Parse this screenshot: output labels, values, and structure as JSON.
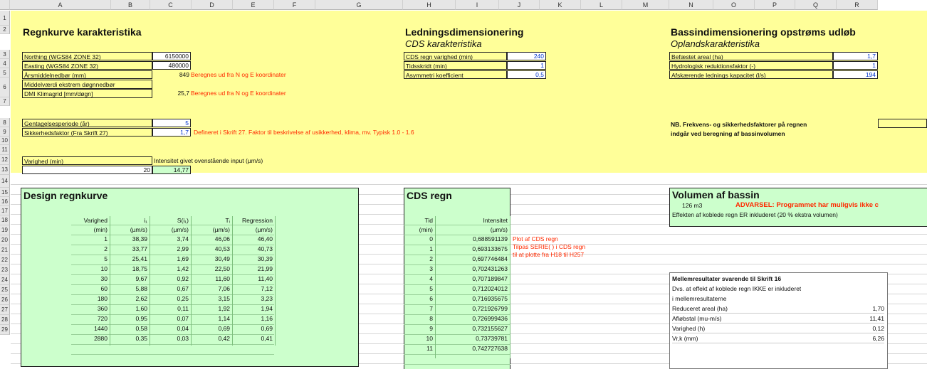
{
  "columns": [
    "A",
    "B",
    "C",
    "D",
    "E",
    "F",
    "G",
    "H",
    "I",
    "J",
    "K",
    "L",
    "M",
    "N",
    "O",
    "P",
    "Q",
    "R"
  ],
  "rows": [
    "1",
    "2",
    "3",
    "4",
    "5",
    "6",
    "",
    "7",
    "8",
    "9",
    "10",
    "11",
    "12",
    "13",
    "14",
    "15",
    "16",
    "17",
    "18",
    "19",
    "20",
    "21",
    "22",
    "23",
    "24",
    "25",
    "26",
    "27",
    "28",
    "29"
  ],
  "regnkurve": {
    "title": "Regnkurve karakteristika",
    "northing_label": "Northing (WGS84 ZONE 32)",
    "northing_value": "6150000",
    "easting_label": "Easting (WGS84 ZONE 32)",
    "easting_value": "480000",
    "aarsmiddel_label": "Årsmiddelnedbør (mm)",
    "aarsmiddel_value": "849",
    "aarsmiddel_note": "Beregnes ud fra N og E koordinater",
    "ekstrem_label1": "Middelværdi ekstrem døgnnedbør",
    "ekstrem_label2": "DMI Klimagrid [mm/døgn]",
    "ekstrem_value": "25,7",
    "ekstrem_note": "Beregnes ud fra N og E koordinater",
    "gentagelse_label": "Gentagelsesperiode (år)",
    "gentagelse_value": "5",
    "sikkerhed_label": "Sikkerhedsfaktor (Fra Skrift 27)",
    "sikkerhed_value": "1,7",
    "sikkerhed_note": "Defineret i Skrift 27. Faktor til beskrivelse af usikkerhed, klima, mv. Typisk 1.0 - 1.6",
    "varighed_label": "Varighed (min)",
    "varighed_value": "20",
    "intensitet_label": "Intensitet givet ovenstående input (µm/s)",
    "intensitet_value": "14,77"
  },
  "ledning": {
    "title": "Ledningsdimensionering",
    "subtitle": "CDS karakteristika",
    "rows": [
      {
        "label": "CDS regn varighed (min)",
        "value": "240"
      },
      {
        "label": "Tidsskridt (min)",
        "value": "1"
      },
      {
        "label": "Asymmetri koefficient",
        "value": "0,5"
      }
    ]
  },
  "bassin": {
    "title": "Bassindimensionering opstrøms udløb",
    "subtitle": "Oplandskarakteristika",
    "rows": [
      {
        "label": "Befæstet areal (ha)",
        "value": "1,7"
      },
      {
        "label": "Hydrologisk reduktionsfaktor (-)",
        "value": "1"
      },
      {
        "label": "Afskærende lednings kapacitet (l/s)",
        "value": "194"
      }
    ],
    "nb_line1": "NB. Frekvens- og sikkerhedsfaktorer på regnen",
    "nb_line2": "indgår ved beregning af bassinvolumen"
  },
  "design": {
    "title": "Design regnkurve",
    "headers1": [
      "Varighed",
      "i₁",
      "S(i₁)",
      "Tᵢ",
      "Regression"
    ],
    "headers2": [
      "(min)",
      "(µm/s)",
      "(µm/s)",
      "(µm/s)",
      "(µm/s)"
    ],
    "data": [
      [
        "1",
        "38,39",
        "3,74",
        "46,06",
        "46,40"
      ],
      [
        "2",
        "33,77",
        "2,99",
        "40,53",
        "40,73"
      ],
      [
        "5",
        "25,41",
        "1,69",
        "30,49",
        "30,39"
      ],
      [
        "10",
        "18,75",
        "1,42",
        "22,50",
        "21,99"
      ],
      [
        "30",
        "9,67",
        "0,92",
        "11,60",
        "11,40"
      ],
      [
        "60",
        "5,88",
        "0,67",
        "7,06",
        "7,12"
      ],
      [
        "180",
        "2,62",
        "0,25",
        "3,15",
        "3,23"
      ],
      [
        "360",
        "1,60",
        "0,11",
        "1,92",
        "1,94"
      ],
      [
        "720",
        "0,95",
        "0,07",
        "1,14",
        "1,16"
      ],
      [
        "1440",
        "0,58",
        "0,04",
        "0,69",
        "0,69"
      ],
      [
        "2880",
        "0,35",
        "0,03",
        "0,42",
        "0,41"
      ]
    ]
  },
  "cds": {
    "title": "CDS regn",
    "headers1": [
      "Tid",
      "Intensitet"
    ],
    "headers2": [
      "(min)",
      "(µm/s)"
    ],
    "data": [
      [
        "0",
        "0,688591139"
      ],
      [
        "1",
        "0,693133675"
      ],
      [
        "2",
        "0,697746484"
      ],
      [
        "3",
        "0,702431263"
      ],
      [
        "4",
        "0,707189847"
      ],
      [
        "5",
        "0,712024012"
      ],
      [
        "6",
        "0,716935675"
      ],
      [
        "7",
        "0,721926799"
      ],
      [
        "8",
        "0,726999436"
      ],
      [
        "9",
        "0,732155627"
      ],
      [
        "10",
        "0,73739781"
      ],
      [
        "11",
        "0,742727638"
      ]
    ],
    "note_lines": [
      "Plot af CDS regn",
      "Tilpas SERIE( ) i CDS regn",
      "til at plotte fra H18 til H257"
    ]
  },
  "volumen": {
    "title": "Volumen af bassin",
    "value": "126 m3",
    "warning": "ADVARSEL: Programmet har muligvis ikke c",
    "effect_note": "Effekten af koblede regn ER inkluderet (20 % ekstra volumen)"
  },
  "mellem": {
    "title": "Mellemresultater svarende til Skrift 16",
    "note1": "Dvs. at effekt af koblede regn IKKE er inkluderet",
    "note2": "i mellemresultaterne",
    "rows": [
      {
        "label": "Reduceret areal (ha)",
        "value": "1,70"
      },
      {
        "label": "Afløbstal (mu-m/s)",
        "value": "11,41"
      },
      {
        "label": "Varighed (h)",
        "value": "0,12"
      },
      {
        "label": "Vr,k (mm)",
        "value": "6,26"
      }
    ]
  }
}
